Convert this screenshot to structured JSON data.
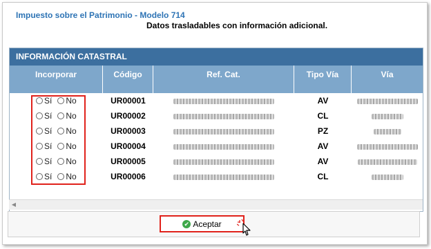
{
  "window": {
    "title": "Impuesto sobre el Patrimonio - Modelo 714",
    "subtitle": "Datos trasladables con información adicional."
  },
  "panel": {
    "section_title": "INFORMACIÓN CATASTRAL",
    "columns": [
      "Incorporar",
      "Código",
      "Ref. Cat.",
      "Tipo Vía",
      "Vía"
    ],
    "radio_yes": "Sí",
    "radio_no": "No",
    "rows": [
      {
        "codigo": "UR00001",
        "tipo_via": "AV"
      },
      {
        "codigo": "UR00002",
        "tipo_via": "CL"
      },
      {
        "codigo": "UR00003",
        "tipo_via": "PZ"
      },
      {
        "codigo": "UR00004",
        "tipo_via": "AV"
      },
      {
        "codigo": "UR00005",
        "tipo_via": "AV"
      },
      {
        "codigo": "UR00006",
        "tipo_via": "CL"
      }
    ]
  },
  "footer": {
    "accept_label": "Aceptar"
  },
  "colors": {
    "title_blue": "#2e74b5",
    "section_header": "#3c6f9f",
    "column_header": "#7ea7cb",
    "highlight_red": "#e0211a",
    "accept_icon_green": "#3ea84a"
  },
  "icons": [
    "check-circle-icon",
    "pointer-cursor-icon",
    "scroll-left-arrow-icon"
  ]
}
